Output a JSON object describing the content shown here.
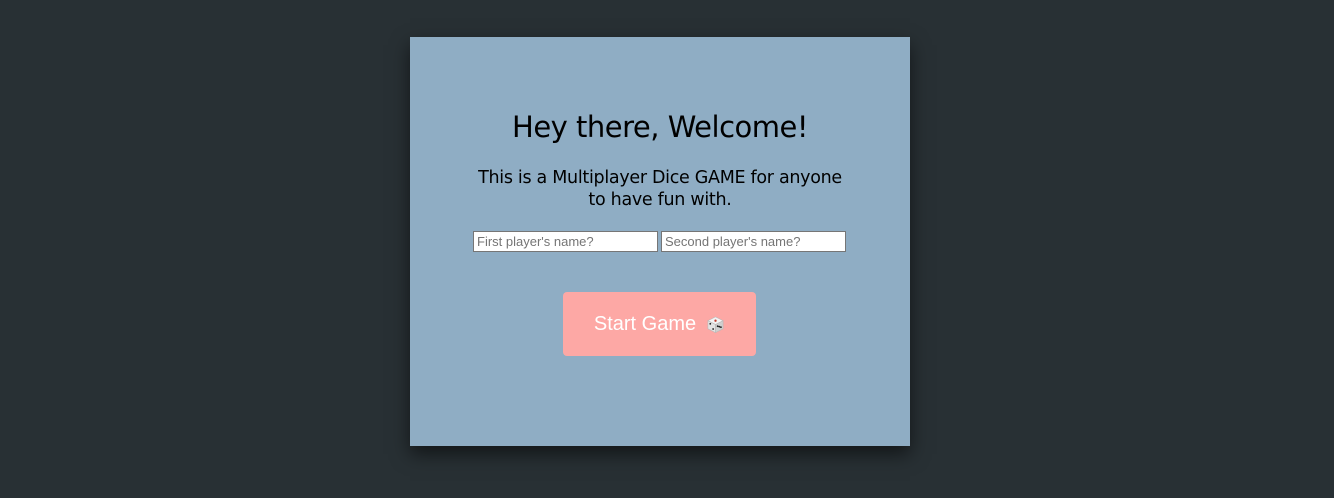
{
  "welcome": {
    "title": "Hey there, Welcome!",
    "subtitle": "This is a Multiplayer Dice GAME for anyone to have fun with."
  },
  "form": {
    "player1_placeholder": "First player's name?",
    "player1_value": "",
    "player2_placeholder": "Second player's name?",
    "player2_value": ""
  },
  "start_button": {
    "label": "Start Game",
    "icon": "dice-icon"
  },
  "colors": {
    "page_background": "#283034",
    "card_background": "#8fadc4",
    "button_background": "#fda8a5",
    "button_text": "#ffffff"
  }
}
